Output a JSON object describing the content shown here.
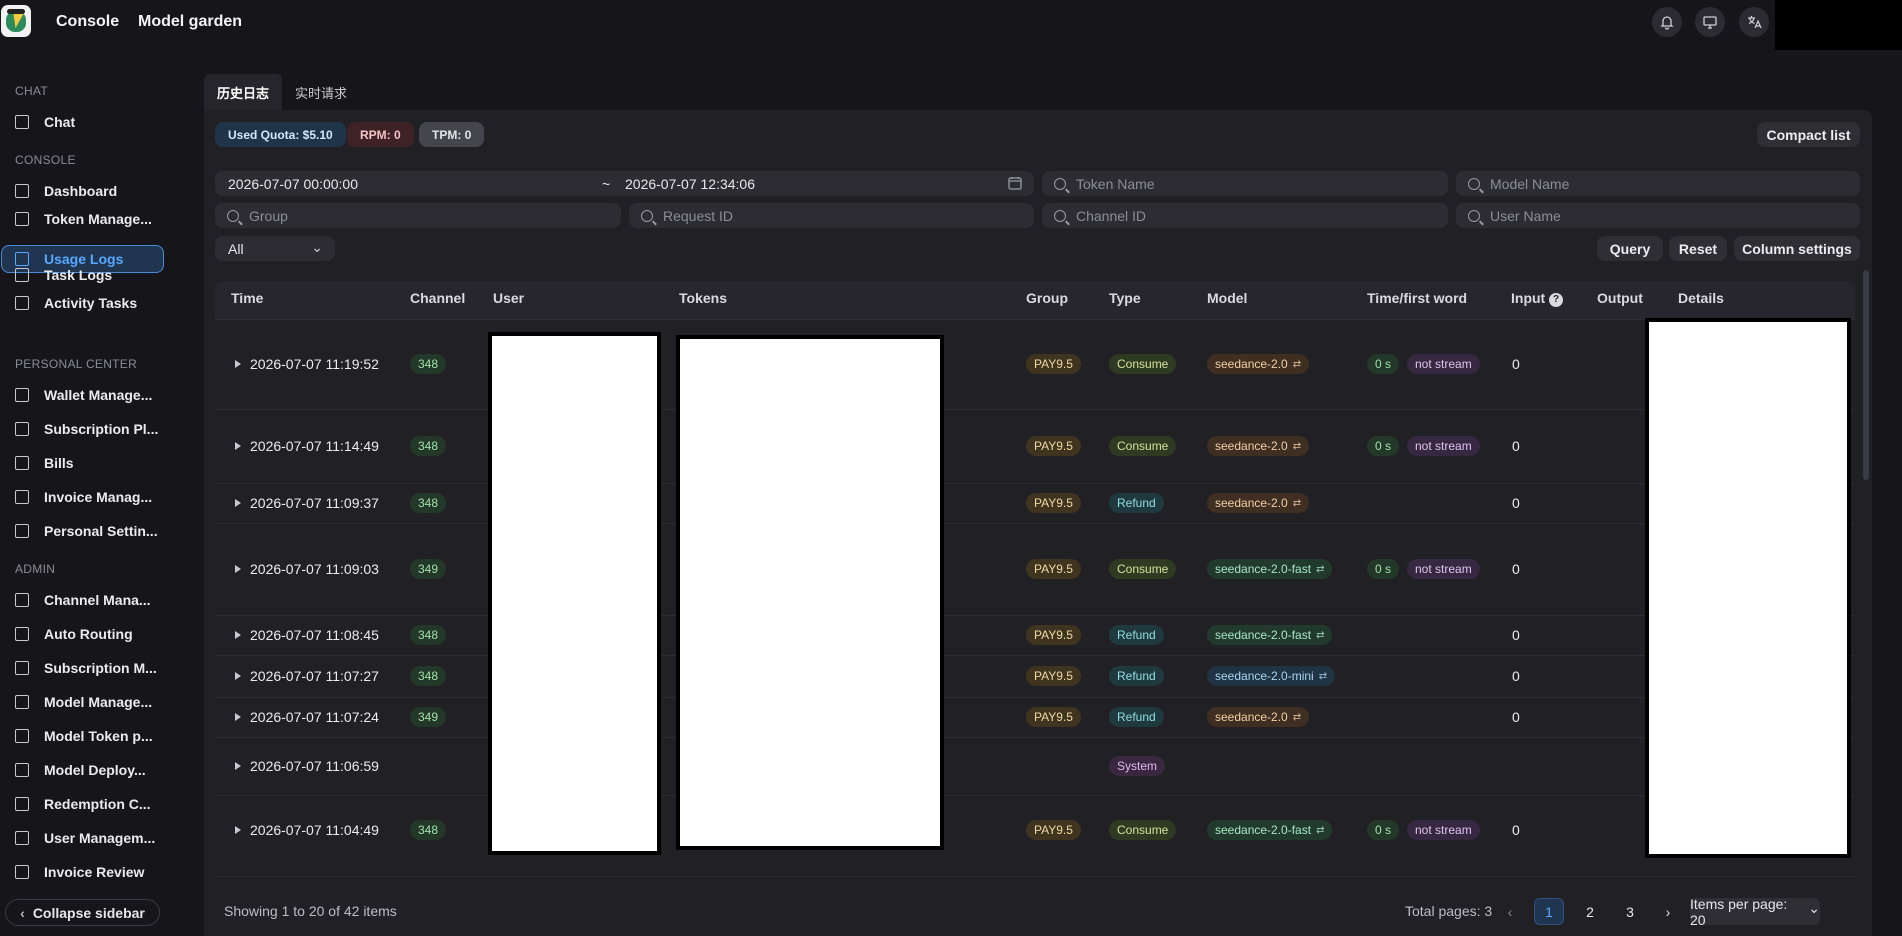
{
  "topbar": {
    "console": "Console",
    "model_garden": "Model garden"
  },
  "sidebar": {
    "sections": [
      {
        "title": "CHAT",
        "items": [
          {
            "label": "Chat",
            "icon": "chat-icon"
          }
        ]
      },
      {
        "title": "CONSOLE",
        "items": [
          {
            "label": "Dashboard",
            "icon": "dashboard-icon"
          },
          {
            "label": "Token Manage...",
            "icon": "key-icon"
          },
          {
            "label": "Usage Logs",
            "icon": "chart-icon",
            "active": true
          },
          {
            "label": "Task Logs",
            "icon": "task-icon"
          },
          {
            "label": "Activity Tasks",
            "icon": "clipboard-icon"
          }
        ]
      },
      {
        "title": "PERSONAL CENTER",
        "items": [
          {
            "label": "Wallet Manage...",
            "icon": "wallet-icon"
          },
          {
            "label": "Subscription Pl...",
            "icon": "calendar-icon"
          },
          {
            "label": "Bills",
            "icon": "bill-icon"
          },
          {
            "label": "Invoice Manag...",
            "icon": "invoice-icon"
          },
          {
            "label": "Personal Settin...",
            "icon": "user-icon"
          }
        ]
      },
      {
        "title": "ADMIN",
        "items": [
          {
            "label": "Channel Mana...",
            "icon": "layers-icon"
          },
          {
            "label": "Auto Routing",
            "icon": "routing-icon"
          },
          {
            "label": "Subscription M...",
            "icon": "calendar-icon"
          },
          {
            "label": "Model Manage...",
            "icon": "box-icon"
          },
          {
            "label": "Model Token p...",
            "icon": "box-icon"
          },
          {
            "label": "Model Deploy...",
            "icon": "server-icon"
          },
          {
            "label": "Redemption C...",
            "icon": "gift-icon"
          },
          {
            "label": "User Managem...",
            "icon": "user-icon"
          },
          {
            "label": "Invoice Review",
            "icon": "invoice-icon"
          }
        ]
      }
    ],
    "collapse_label": "Collapse sidebar"
  },
  "tabs": [
    "历史日志",
    "实时请求"
  ],
  "stats": {
    "quota": "Used Quota: $5.10",
    "rpm": "RPM: 0",
    "tpm": "TPM: 0"
  },
  "compact_label": "Compact list",
  "filters": {
    "date_start": "2026-07-07 00:00:00",
    "date_sep": "~",
    "date_end": "2026-07-07 12:34:06",
    "token_name": "Token Name",
    "model_name": "Model Name",
    "group": "Group",
    "request_id": "Request ID",
    "channel_id": "Channel ID",
    "user_name": "User Name",
    "type_select": "All"
  },
  "actions": {
    "query": "Query",
    "reset": "Reset",
    "columns": "Column settings"
  },
  "table": {
    "headers": {
      "time": "Time",
      "channel": "Channel",
      "user": "User",
      "tokens": "Tokens",
      "group": "Group",
      "type": "Type",
      "model": "Model",
      "time_first_word": "Time/first word",
      "input": "Input",
      "output": "Output",
      "details": "Details"
    },
    "rows": [
      {
        "time": "2026-07-07 11:19:52",
        "channel": "348",
        "group": "PAY9.5",
        "type": "Consume",
        "model": "seedance-2.0",
        "first": "0 s",
        "stream": "not stream",
        "input": "0"
      },
      {
        "time": "2026-07-07 11:14:49",
        "channel": "348",
        "group": "PAY9.5",
        "type": "Consume",
        "model": "seedance-2.0",
        "first": "0 s",
        "stream": "not stream",
        "input": "0"
      },
      {
        "time": "2026-07-07 11:09:37",
        "channel": "348",
        "group": "PAY9.5",
        "type": "Refund",
        "model": "seedance-2.0",
        "first": "",
        "stream": "",
        "input": "0"
      },
      {
        "time": "2026-07-07 11:09:03",
        "channel": "349",
        "group": "PAY9.5",
        "type": "Consume",
        "model": "seedance-2.0-fast",
        "first": "0 s",
        "stream": "not stream",
        "input": "0"
      },
      {
        "time": "2026-07-07 11:08:45",
        "channel": "348",
        "group": "PAY9.5",
        "type": "Refund",
        "model": "seedance-2.0-fast",
        "first": "",
        "stream": "",
        "input": "0"
      },
      {
        "time": "2026-07-07 11:07:27",
        "channel": "348",
        "group": "PAY9.5",
        "type": "Refund",
        "model": "seedance-2.0-mini",
        "first": "",
        "stream": "",
        "input": "0"
      },
      {
        "time": "2026-07-07 11:07:24",
        "channel": "349",
        "group": "PAY9.5",
        "type": "Refund",
        "model": "seedance-2.0",
        "first": "",
        "stream": "",
        "input": "0"
      },
      {
        "time": "2026-07-07 11:06:59",
        "channel": "",
        "group": "",
        "type": "System",
        "model": "",
        "first": "",
        "stream": "",
        "input": ""
      },
      {
        "time": "2026-07-07 11:04:49",
        "channel": "348",
        "group": "PAY9.5",
        "type": "Consume",
        "model": "seedance-2.0-fast",
        "first": "0 s",
        "stream": "not stream",
        "input": "0"
      }
    ]
  },
  "footer": {
    "showing": "Showing 1 to 20 of 42 items",
    "total_pages": "Total pages: 3",
    "pages": [
      "1",
      "2",
      "3"
    ],
    "current_page": "1",
    "per_page": "Items per page: 20"
  },
  "colors": {
    "accent": "#58a8ff",
    "background": "#16161a",
    "panel": "#202025"
  }
}
